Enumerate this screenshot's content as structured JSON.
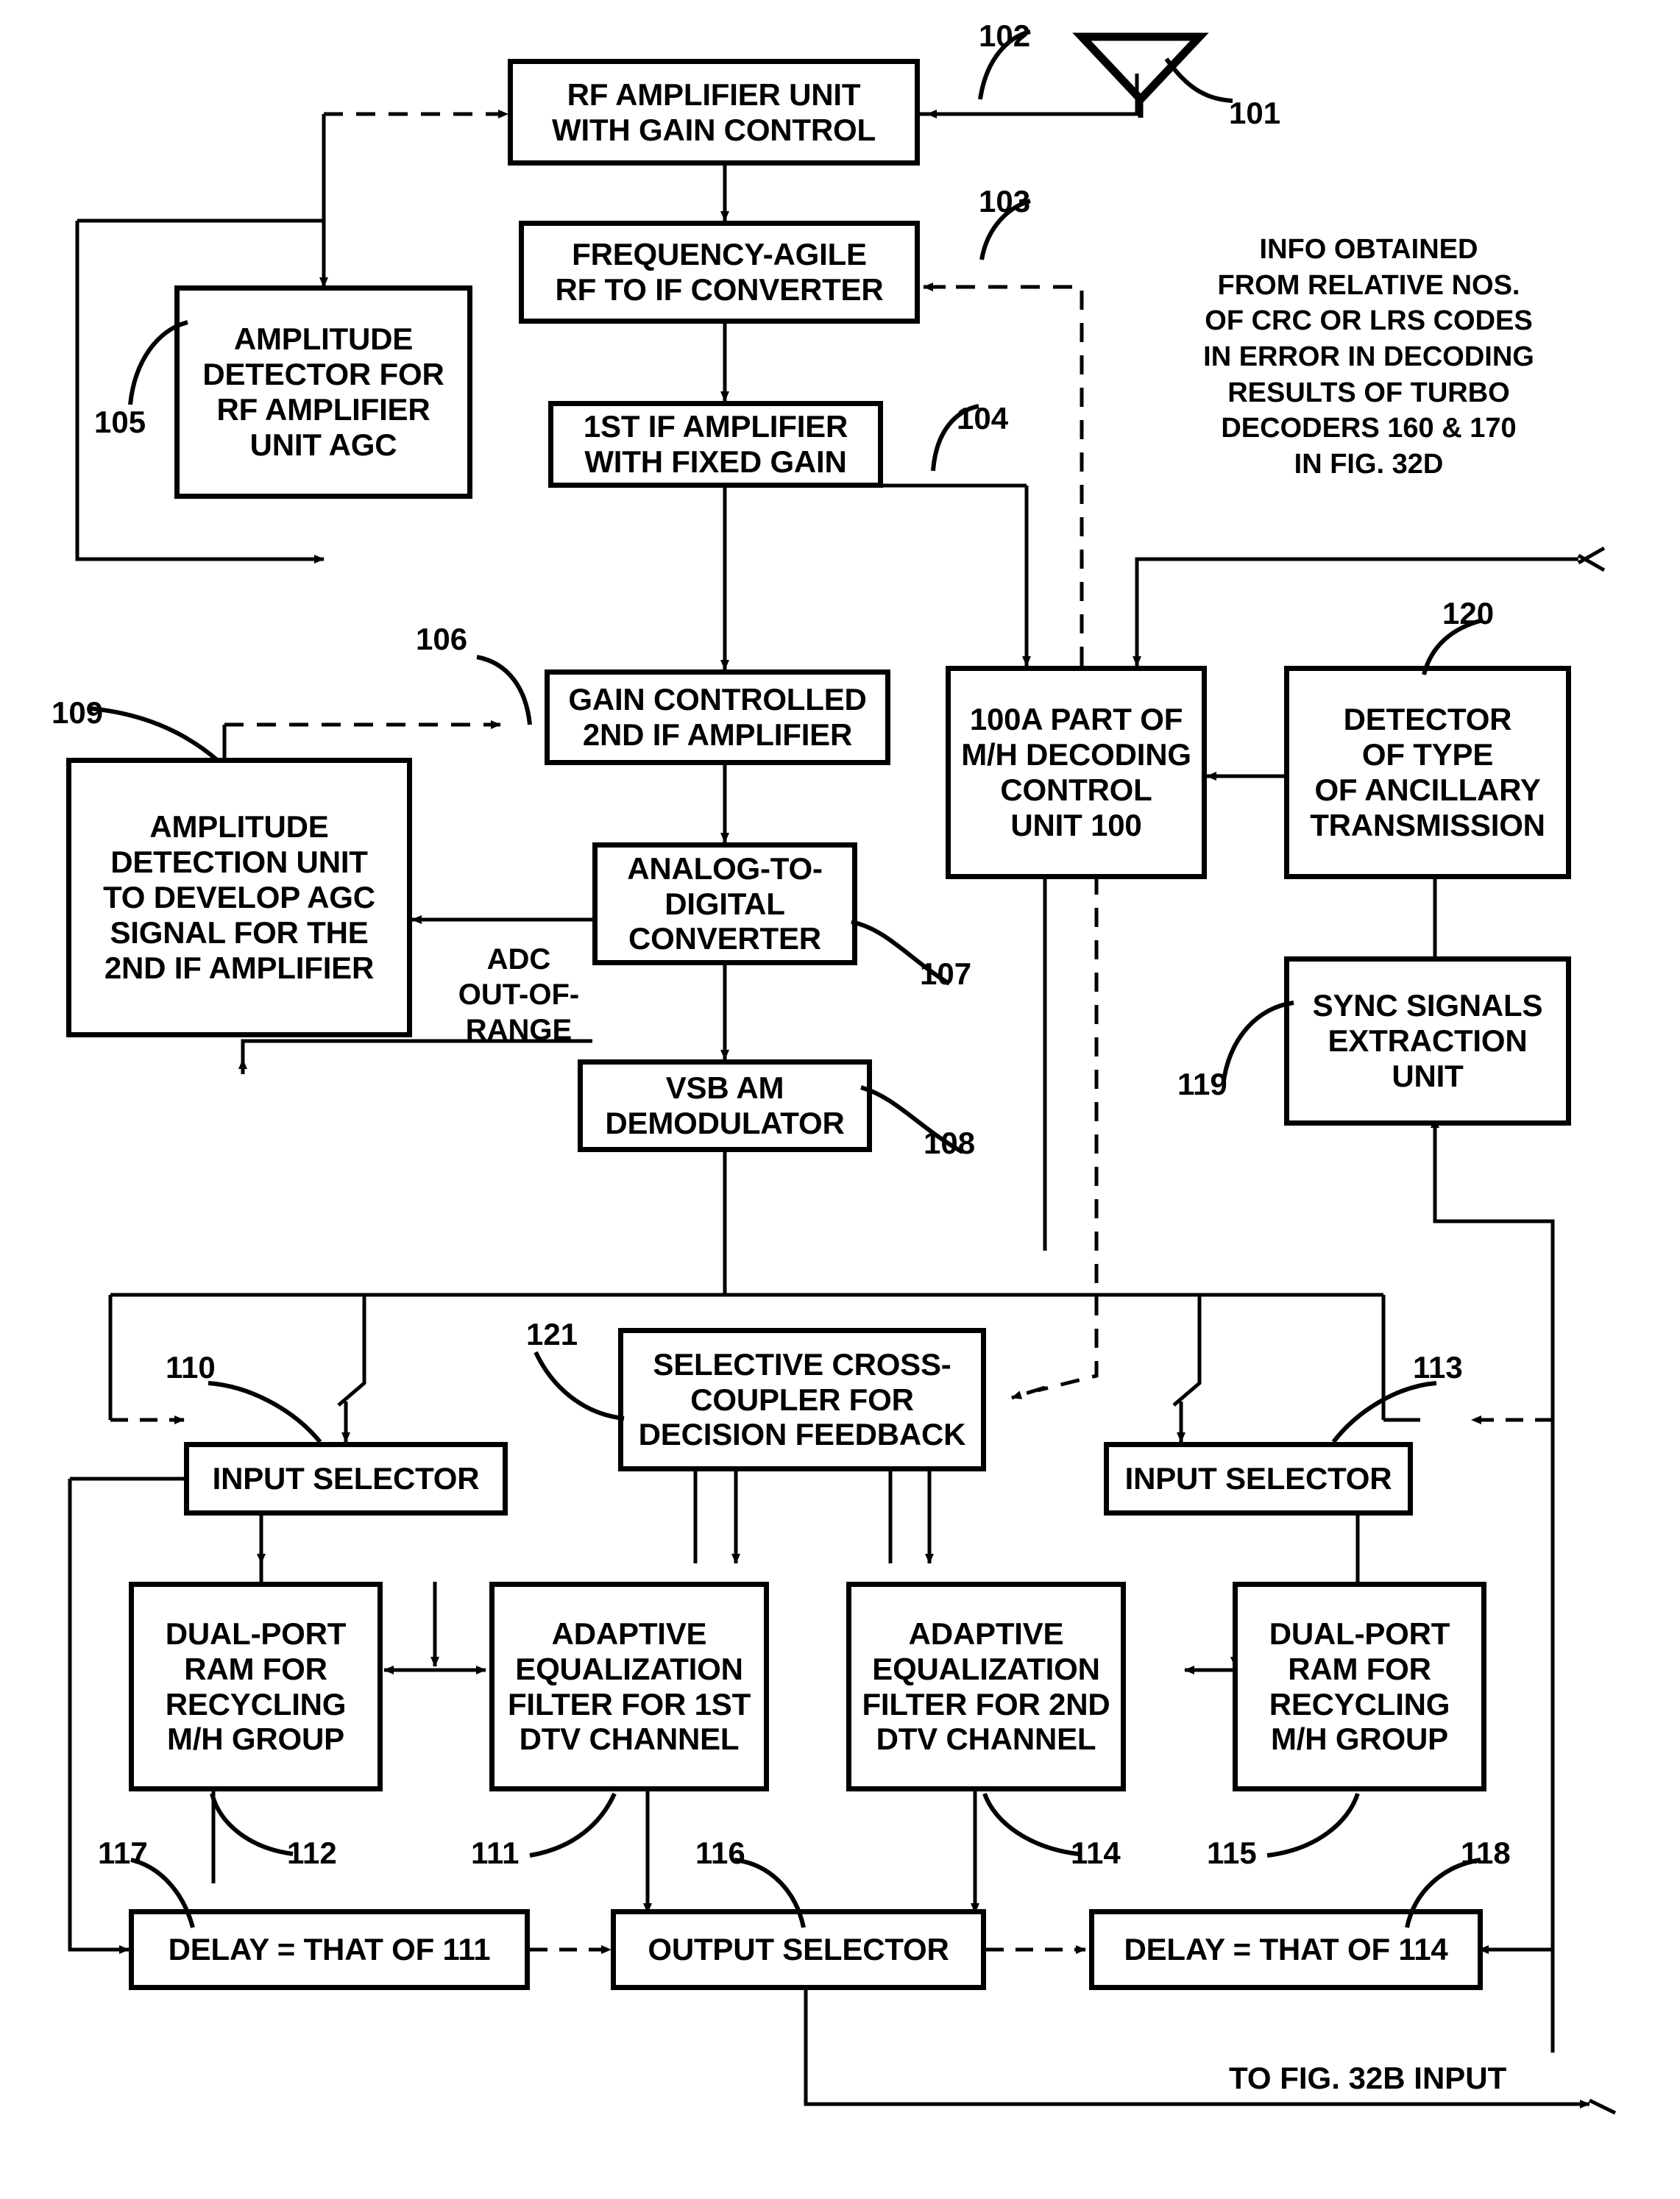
{
  "figure": {
    "type": "patent-block-diagram",
    "antenna_symbol": "antenna-triangle"
  },
  "blocks": [
    {
      "id": "102",
      "label": "RF  AMPLIFIER UNIT\nWITH GAIN CONTROL",
      "ref": "102"
    },
    {
      "id": "103",
      "label": "FREQUENCY-AGILE\nRF TO IF CONVERTER",
      "ref": "103"
    },
    {
      "id": "104",
      "label": "1ST IF AMPLIFIER\nWITH FIXED GAIN",
      "ref": "104"
    },
    {
      "id": "105",
      "label": "AMPLITUDE\nDETECTOR FOR\nRF AMPLIFIER\nUNIT AGC",
      "ref": "105"
    },
    {
      "id": "106",
      "label": "GAIN CONTROLLED\n2ND IF  AMPLIFIER",
      "ref": "106"
    },
    {
      "id": "109",
      "label": "AMPLITUDE\nDETECTION UNIT\nTO DEVELOP AGC\nSIGNAL FOR THE\n2ND IF AMPLIFIER",
      "ref": "109"
    },
    {
      "id": "107",
      "label": "ANALOG-TO-\nDIGITAL\nCONVERTER",
      "ref": "107"
    },
    {
      "id": "108",
      "label": "VSB AM\nDEMODULATOR",
      "ref": "108"
    },
    {
      "id": "100A",
      "label": "100A PART OF\nM/H DECODING\nCONTROL\nUNIT 100",
      "ref": ""
    },
    {
      "id": "120",
      "label": "DETECTOR\nOF TYPE\nOF ANCILLARY\nTRANSMISSION",
      "ref": "120"
    },
    {
      "id": "119",
      "label": "SYNC SIGNALS\nEXTRACTION\nUNIT",
      "ref": "119"
    },
    {
      "id": "121",
      "label": "SELECTIVE CROSS-\nCOUPLER FOR\nDECISION FEEDBACK",
      "ref": "121"
    },
    {
      "id": "110",
      "label": "INPUT SELECTOR",
      "ref": "110"
    },
    {
      "id": "113",
      "label": "INPUT SELECTOR",
      "ref": "113"
    },
    {
      "id": "112",
      "label": "DUAL-PORT\nRAM FOR\nRECYCLING\nM/H GROUP",
      "ref": "112"
    },
    {
      "id": "111",
      "label": "ADAPTIVE\nEQUALIZATION\nFILTER FOR 1ST\nDTV CHANNEL",
      "ref": "111"
    },
    {
      "id": "114",
      "label": "ADAPTIVE\nEQUALIZATION\nFILTER FOR 2ND\nDTV CHANNEL",
      "ref": "114"
    },
    {
      "id": "115",
      "label": "DUAL-PORT\nRAM FOR\nRECYCLING\nM/H GROUP",
      "ref": "115"
    },
    {
      "id": "117",
      "label": "DELAY = THAT OF 111",
      "ref": "117"
    },
    {
      "id": "116",
      "label": "OUTPUT SELECTOR",
      "ref": "116"
    },
    {
      "id": "118",
      "label": "DELAY = THAT OF 114",
      "ref": "118"
    }
  ],
  "box_text": {
    "rf_amplifier": "RF  AMPLIFIER UNIT\nWITH GAIN CONTROL",
    "freq_agile": "FREQUENCY-AGILE\nRF TO IF CONVERTER",
    "first_if": "1ST IF AMPLIFIER\nWITH FIXED GAIN",
    "amp_det_rf": "AMPLITUDE\nDETECTOR FOR\nRF AMPLIFIER\nUNIT AGC",
    "gain_ctrl_2nd_if": "GAIN CONTROLLED\n2ND IF  AMPLIFIER",
    "amp_det_unit": "AMPLITUDE\nDETECTION UNIT\nTO DEVELOP AGC\nSIGNAL FOR THE\n2ND IF AMPLIFIER",
    "adc": "ANALOG-TO-\nDIGITAL\nCONVERTER",
    "vsb_demod": "VSB AM\nDEMODULATOR",
    "mh_control": "100A PART OF\nM/H DECODING\nCONTROL\nUNIT 100",
    "ancillary_detector": "DETECTOR\nOF TYPE\nOF ANCILLARY\nTRANSMISSION",
    "sync_extract": "SYNC SIGNALS\nEXTRACTION\nUNIT",
    "cross_coupler": "SELECTIVE CROSS-\nCOUPLER FOR\nDECISION FEEDBACK",
    "input_selector_left": "INPUT SELECTOR",
    "input_selector_right": "INPUT SELECTOR",
    "ram_left": "DUAL-PORT\nRAM FOR\nRECYCLING\nM/H GROUP",
    "filter_1st": "ADAPTIVE\nEQUALIZATION\nFILTER FOR 1ST\nDTV CHANNEL",
    "filter_2nd": "ADAPTIVE\nEQUALIZATION\nFILTER FOR 2ND\nDTV CHANNEL",
    "ram_right": "DUAL-PORT\nRAM FOR\nRECYCLING\nM/H GROUP",
    "delay_left": "DELAY = THAT OF 111",
    "output_selector": "OUTPUT SELECTOR",
    "delay_right": "DELAY = THAT OF 114"
  },
  "refs": {
    "r101": "101",
    "r102": "102",
    "r103": "103",
    "r104": "104",
    "r105": "105",
    "r106": "106",
    "r107": "107",
    "r108": "108",
    "r109": "109",
    "r110": "110",
    "r111": "111",
    "r112": "112",
    "r113": "113",
    "r114": "114",
    "r115": "115",
    "r116": "116",
    "r117": "117",
    "r118": "118",
    "r119": "119",
    "r120": "120",
    "r121": "121"
  },
  "annotations": {
    "info_note": "INFO OBTAINED\nFROM RELATIVE NOS.\nOF CRC OR LRS CODES\nIN ERROR IN DECODING\nRESULTS OF TURBO\nDECODERS 160 & 170\nIN FIG. 32D",
    "adc_out_of_range": "ADC\nOUT-OF-\nRANGE",
    "to_fig_32b": "TO FIG. 32B INPUT"
  },
  "colors": {
    "line": "#000000",
    "background": "#ffffff"
  }
}
